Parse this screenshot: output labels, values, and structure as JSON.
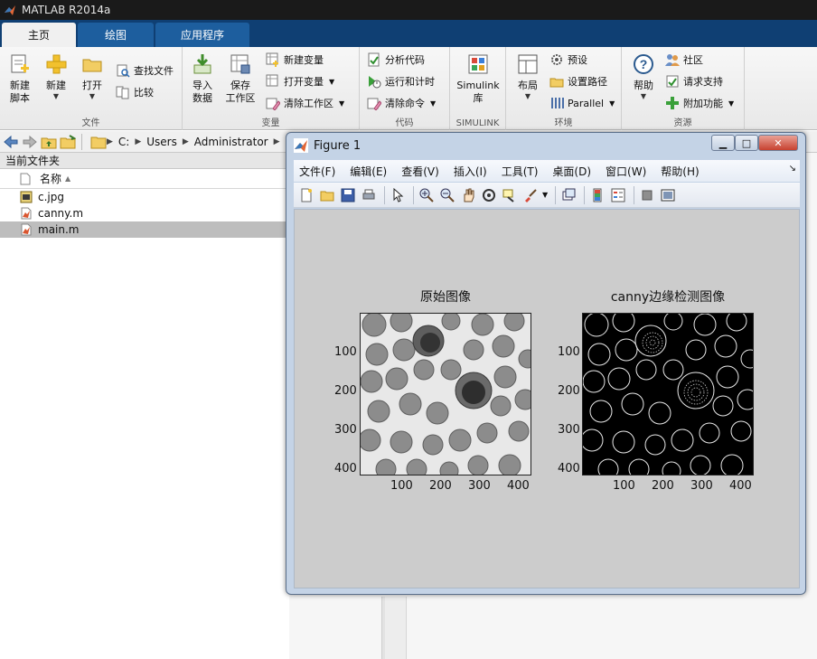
{
  "app": {
    "title": "MATLAB R2014a"
  },
  "ribbon_tabs": [
    {
      "label": "主页"
    },
    {
      "label": "绘图"
    },
    {
      "label": "应用程序"
    }
  ],
  "ribbon": {
    "file_group": {
      "label": "文件",
      "new_script": "新建\n脚本",
      "new": "新建",
      "open": "打开",
      "find_files": "查找文件",
      "compare": "比较"
    },
    "variable_group": {
      "label": "变量",
      "import_data": "导入\n数据",
      "save_workspace": "保存\n工作区",
      "new_variable": "新建变量",
      "open_variable": "打开变量",
      "clear_workspace": "清除工作区"
    },
    "code_group": {
      "label": "代码",
      "analyze_code": "分析代码",
      "run_and_time": "运行和计时",
      "clear_commands": "清除命令"
    },
    "simulink_group": {
      "label": "SIMULINK",
      "library": "Simulink\n库"
    },
    "env_group": {
      "label": "环境",
      "layout": "布局",
      "preferences": "预设",
      "set_path": "设置路径",
      "parallel": "Parallel"
    },
    "resources_group": {
      "label": "资源",
      "help": "帮助",
      "community": "社区",
      "request_support": "请求支持",
      "add_ons": "附加功能"
    }
  },
  "address_bar": {
    "path": [
      "C:",
      "Users",
      "Administrator"
    ]
  },
  "current_folder": {
    "title": "当前文件夹",
    "column_name": "名称",
    "files": [
      {
        "name": "c.jpg",
        "type": "image"
      },
      {
        "name": "canny.m",
        "type": "mfile"
      },
      {
        "name": "main.m",
        "type": "mfile",
        "selected": true
      }
    ]
  },
  "figure": {
    "title": "Figure 1",
    "menus": [
      "文件(F)",
      "编辑(E)",
      "查看(V)",
      "插入(I)",
      "工具(T)",
      "桌面(D)",
      "窗口(W)",
      "帮助(H)"
    ],
    "axes": [
      {
        "title": "原始图像",
        "y_ticks": [
          "100",
          "200",
          "300",
          "400"
        ],
        "x_ticks": [
          "100",
          "200",
          "300",
          "400"
        ]
      },
      {
        "title": "canny边缘检测图像",
        "y_ticks": [
          "100",
          "200",
          "300",
          "400"
        ],
        "x_ticks": [
          "100",
          "200",
          "300",
          "400"
        ]
      }
    ]
  }
}
